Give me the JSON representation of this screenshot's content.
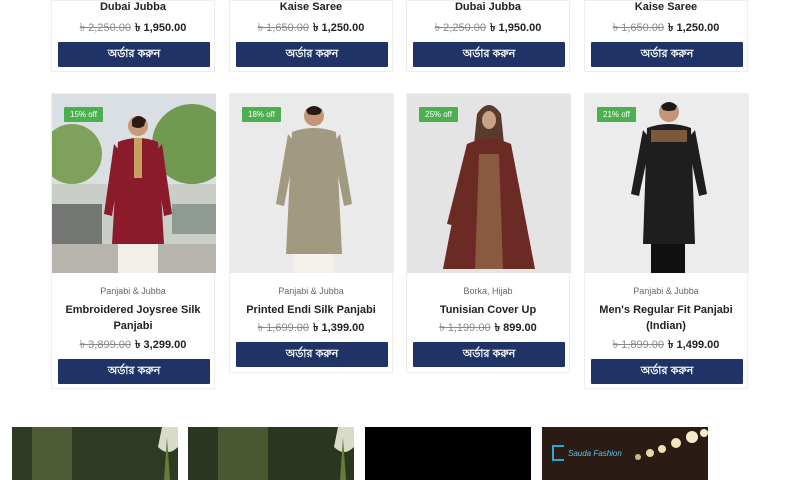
{
  "top_row": [
    {
      "name": "Dubai Jubba",
      "old_price": "৳ 2,250.00",
      "new_price": "৳ 1,950.00",
      "button": "অর্ডার করুন"
    },
    {
      "name": "Kaise Saree",
      "old_price": "৳ 1,650.00",
      "new_price": "৳ 1,250.00",
      "button": "অর্ডার করুন"
    },
    {
      "name": "Dubai Jubba",
      "old_price": "৳ 2,250.00",
      "new_price": "৳ 1,950.00",
      "button": "অর্ডার করুন"
    },
    {
      "name": "Kaise Saree",
      "old_price": "৳ 1,650.00",
      "new_price": "৳ 1,250.00",
      "button": "অর্ডার করুন"
    }
  ],
  "products": [
    {
      "badge": "15% off",
      "category": "Panjabi & Jubba",
      "name": "Embroidered Joysree Silk Panjabi",
      "old_price": "৳ 3,899.00",
      "new_price": "৳ 3,299.00",
      "button": "অর্ডার করুন",
      "outfit_color": "#8b1a2b"
    },
    {
      "badge": "18% off",
      "category": "Panjabi & Jubba",
      "name": "Printed Endi Silk Panjabi",
      "old_price": "৳ 1,699.00",
      "new_price": "৳ 1,399.00",
      "button": "অর্ডার করুন",
      "outfit_color": "#a19a80"
    },
    {
      "badge": "25% off",
      "category": "Borka, Hijab",
      "name": "Tunisian Cover Up",
      "old_price": "৳ 1,199.00",
      "new_price": "৳ 899.00",
      "button": "অর্ডার করুন",
      "outfit_color": "#6b2a24"
    },
    {
      "badge": "21% off",
      "category": "Panjabi & Jubba",
      "name": "Men's Regular Fit Panjabi (Indian)",
      "old_price": "৳ 1,899.00",
      "new_price": "৳ 1,499.00",
      "button": "অর্ডার করুন",
      "outfit_color": "#1e1e1e"
    }
  ],
  "banners": [
    {
      "label": ""
    },
    {
      "label": ""
    },
    {
      "label": ""
    },
    {
      "logo_text": "Sauda Fashion"
    }
  ],
  "colors": {
    "button": "#1f3366",
    "badge": "#4caf50",
    "logo": "#2aa8d8"
  }
}
